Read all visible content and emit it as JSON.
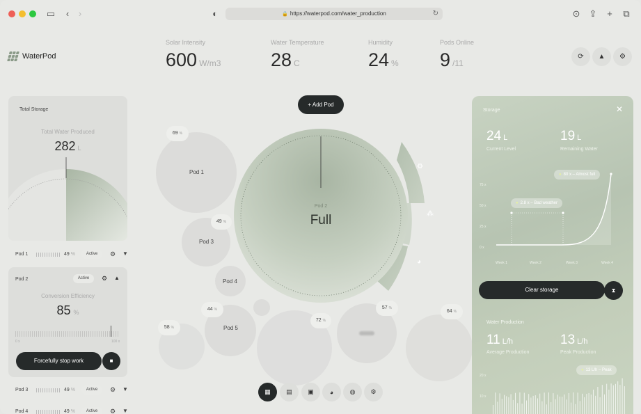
{
  "browser": {
    "url": "https://waterpod.com/water_production"
  },
  "app": {
    "name": "WaterPod"
  },
  "stats": [
    {
      "label": "Solar Intensity",
      "value": "600",
      "unit": "W/m3"
    },
    {
      "label": "Water Temperature",
      "value": "28",
      "unit": "C"
    },
    {
      "label": "Humidity",
      "value": "24",
      "unit": "%"
    },
    {
      "label": "Pods Online",
      "value": "9",
      "unit": "/11"
    }
  ],
  "storage_card": {
    "title": "Total Storage",
    "label": "Total Water Produced",
    "value": "282",
    "unit": "L"
  },
  "pod_rows": [
    {
      "name": "Pod 1",
      "pct": "49",
      "status": "Active"
    },
    {
      "name": "Pod 3",
      "pct": "49",
      "status": "Active"
    },
    {
      "name": "Pod 4",
      "pct": "49",
      "status": "Active"
    }
  ],
  "pod2_card": {
    "name": "Pod 2",
    "status": "Active",
    "label": "Conversion Efficiency",
    "value": "85",
    "unit": "%",
    "scale_min": "0 x",
    "scale_max": "100 x",
    "stop_label": "Forcefully stop work"
  },
  "add_pod_label": "Add Pod",
  "center": {
    "sub": "Pod 2",
    "main": "Full"
  },
  "bubbles": [
    {
      "label": "Pod 1",
      "chip": "69",
      "chip_unit": "%"
    },
    {
      "label": "Pod 3",
      "chip": "49",
      "chip_unit": "%"
    },
    {
      "label": "Pod 4"
    },
    {
      "label": "Pod 5",
      "chip": "44",
      "chip_unit": "%"
    },
    {
      "chip": "58",
      "chip_unit": "%"
    },
    {
      "chip": "72",
      "chip_unit": "%"
    },
    {
      "chip": "57",
      "chip_unit": "%"
    },
    {
      "chip": "64",
      "chip_unit": "%"
    }
  ],
  "storage_panel": {
    "title": "Storage",
    "current_value": "24",
    "current_unit": "L",
    "current_label": "Current Level",
    "remaining_value": "19",
    "remaining_unit": "L",
    "remaining_label": "Remaining Water",
    "tag_full": {
      "value": "80",
      "text": "Almost full"
    },
    "tag_bad": {
      "value": "2.8",
      "text": "Bad weather"
    },
    "tag_unit": "x",
    "y_ticks": [
      "75 x",
      "50 x",
      "25 x",
      "0 x"
    ],
    "x_ticks": [
      "Week 1",
      "Week 2",
      "Week 3",
      "Week 4"
    ],
    "clear_label": "Clear storage"
  },
  "production_panel": {
    "title": "Water Production",
    "avg_value": "11",
    "avg_unit": "L/h",
    "avg_label": "Average Production",
    "peak_value": "13",
    "peak_unit": "L/h",
    "peak_label": "Peak Production",
    "peak_tag": {
      "value": "13",
      "unit": "L/h",
      "text": "Peak"
    },
    "y_ticks": [
      "20 x",
      "10 x"
    ]
  },
  "icons": {
    "refresh": "refresh-icon",
    "alert": "alert-icon",
    "settings": "gear-icon"
  }
}
